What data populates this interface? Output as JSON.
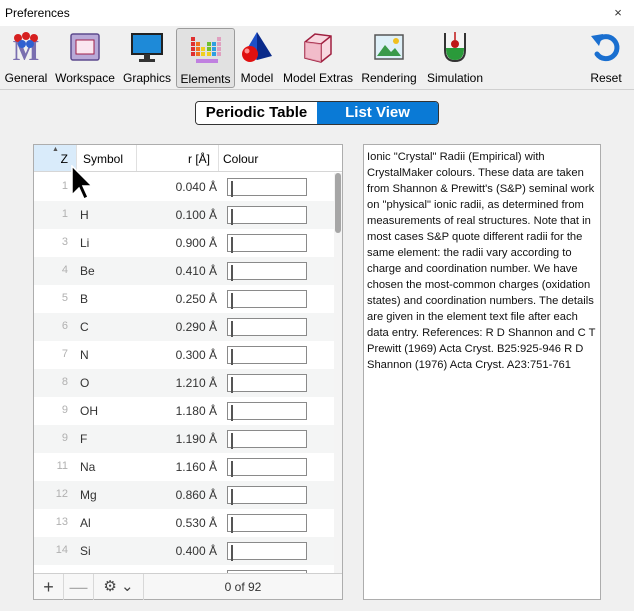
{
  "window": {
    "title": "Preferences",
    "close_glyph": "×"
  },
  "toolbar": {
    "items": [
      {
        "label": "General",
        "icon": "molecule-m-icon"
      },
      {
        "label": "Workspace",
        "icon": "window-icon"
      },
      {
        "label": "Graphics",
        "icon": "monitor-icon"
      },
      {
        "label": "Elements",
        "icon": "periodic-table-icon",
        "active": true
      },
      {
        "label": "Model",
        "icon": "shapes-icon"
      },
      {
        "label": "Model Extras",
        "icon": "cube-icon"
      },
      {
        "label": "Rendering",
        "icon": "picture-icon"
      },
      {
        "label": "Simulation",
        "icon": "beaker-icon"
      }
    ],
    "reset_label": "Reset"
  },
  "view_switch": {
    "periodic_table": "Periodic Table",
    "list_view": "List View",
    "selected": "List View"
  },
  "table": {
    "headers": {
      "z": "Z",
      "symbol": "Symbol",
      "radius": "r [Å]",
      "colour": "Colour"
    },
    "rows": [
      {
        "z": "1",
        "symbol": "",
        "radius": "0.040 Å",
        "color": "#e6e6fa"
      },
      {
        "z": "1",
        "symbol": "H",
        "radius": "0.100 Å",
        "color": "#ffb6c1"
      },
      {
        "z": "3",
        "symbol": "Li",
        "radius": "0.900 Å",
        "color": "#4f7fa4"
      },
      {
        "z": "4",
        "symbol": "Be",
        "radius": "0.410 Å",
        "color": "#98fb98"
      },
      {
        "z": "5",
        "symbol": "B",
        "radius": "0.250 Å",
        "color": "#8b88b0"
      },
      {
        "z": "6",
        "symbol": "C",
        "radius": "0.290 Å",
        "color": "#000000"
      },
      {
        "z": "7",
        "symbol": "N",
        "radius": "0.300 Å",
        "color": "#7fa8f0"
      },
      {
        "z": "8",
        "symbol": "O",
        "radius": "1.210 Å",
        "color": "#ff0000"
      },
      {
        "z": "9",
        "symbol": "OH",
        "radius": "1.180 Å",
        "color": "#c45a0e"
      },
      {
        "z": "9",
        "symbol": "F",
        "radius": "1.190 Å",
        "color": "#00cc00"
      },
      {
        "z": "11",
        "symbol": "Na",
        "radius": "1.160 Å",
        "color": "#c8c800"
      },
      {
        "z": "12",
        "symbol": "Mg",
        "radius": "0.860 Å",
        "color": "#ffc000"
      },
      {
        "z": "13",
        "symbol": "Al",
        "radius": "0.530 Å",
        "color": "#20a8f0"
      },
      {
        "z": "14",
        "symbol": "Si",
        "radius": "0.400 Å",
        "color": "#0000ff"
      },
      {
        "z": "",
        "symbol": "",
        "radius": "",
        "color": "#808080"
      }
    ],
    "footer": {
      "add": "+",
      "remove": "—",
      "gear": "⚙ ⌄",
      "count": "0 of 92"
    }
  },
  "description": "Ionic \"Crystal\" Radii (Empirical) with CrystalMaker colours. These data are taken from Shannon & Prewitt's (S&P) seminal work on \"physical\" ionic radii, as determined from measurements of real structures. Note that in most cases S&P quote different radii for the same element: the radii vary according to charge and coordination number. We have chosen the most-common charges (oxidation states) and coordination numbers. The details are given in the element text file after each data entry. References: R D Shannon and C T Prewitt (1969) Acta Cryst. B25:925-946 R D Shannon (1976) Acta Cryst. A23:751-761"
}
